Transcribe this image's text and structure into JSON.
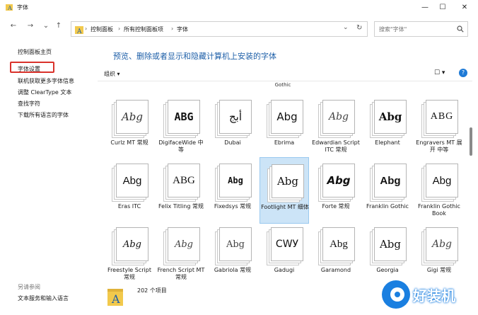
{
  "window": {
    "title": "字体",
    "min_icon": "minimize-icon",
    "max_icon": "maximize-icon",
    "close_icon": "close-icon"
  },
  "nav": {
    "back": "←",
    "forward": "→",
    "recent": "⌄",
    "up": "↑",
    "breadcrumbs": [
      "控制面板",
      "所有控制面板项",
      "字体"
    ],
    "dropdown": "⌄",
    "refresh": "↻",
    "search_placeholder": "搜索\"字体\""
  },
  "sidebar": {
    "items": [
      "控制面板主页",
      "字体设置",
      "联机获取更多字体信息",
      "调整 ClearType 文本",
      "查找字符",
      "下载所有语言的字体"
    ],
    "see_also_title": "另请参阅",
    "see_also": [
      "文本服务和输入语言"
    ]
  },
  "header": "预览、删除或者显示和隐藏计算机上安装的字体",
  "toolbar": {
    "organize": "组织 ▾",
    "view": "☐ ▾",
    "help": "?"
  },
  "top_partial": {
    "line1": "Gothic"
  },
  "fonts": [
    {
      "preview": "Abg",
      "name": "Curlz MT 常规"
    },
    {
      "preview": "ABG",
      "name": "DigifaceWide 中等"
    },
    {
      "preview": "أبج",
      "name": "Dubai"
    },
    {
      "preview": "Abg",
      "name": "Ebrima"
    },
    {
      "preview": "Abg",
      "name": "Edwardian Script ITC 常规"
    },
    {
      "preview": "Abg",
      "name": "Elephant"
    },
    {
      "preview": "ABG",
      "name": "Engravers MT 展开 中等"
    },
    {
      "preview": "Abg",
      "name": "Eras ITC"
    },
    {
      "preview": "ABG",
      "name": "Felix Titling 常规"
    },
    {
      "preview": "Abg",
      "name": "Fixedsys 常规"
    },
    {
      "preview": "Abg",
      "name": "Footlight MT 细体"
    },
    {
      "preview": "Abg",
      "name": "Forte 常规"
    },
    {
      "preview": "Abg",
      "name": "Franklin Gothic"
    },
    {
      "preview": "Abg",
      "name": "Franklin Gothic Book"
    },
    {
      "preview": "Abg",
      "name": "Freestyle Script 常规"
    },
    {
      "preview": "Abg",
      "name": "French Script MT 常规"
    },
    {
      "preview": "Abg",
      "name": "Gabriola 常规"
    },
    {
      "preview": "СWУ",
      "name": "Gadugi"
    },
    {
      "preview": "Abg",
      "name": "Garamond"
    },
    {
      "preview": "Abg",
      "name": "Georgia"
    },
    {
      "preview": "Abg",
      "name": "Gigi 常规"
    }
  ],
  "status": {
    "count": "202 个项目"
  },
  "watermark": "好装机"
}
